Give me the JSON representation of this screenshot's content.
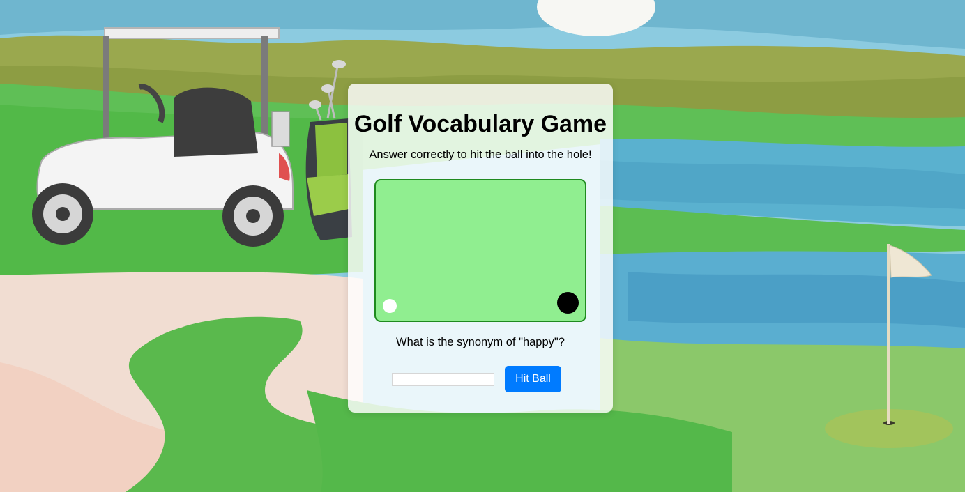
{
  "game": {
    "title": "Golf Vocabulary Game",
    "instructions": "Answer correctly to hit the ball into the hole!",
    "question": "What is the synonym of \"happy\"?",
    "answer_value": "",
    "answer_placeholder": "",
    "hit_button_label": "Hit Ball"
  },
  "course": {
    "fill_color": "#90ee90",
    "border_color": "#1f8a1f",
    "ball_color": "#ffffff",
    "hole_color": "#000000"
  },
  "colors": {
    "button_accent": "#007bff"
  },
  "background": {
    "scene": "watercolor golf course",
    "elements": [
      "golf-cart",
      "golf-bag",
      "water-hazard",
      "sand-bunker",
      "putting-green",
      "flag"
    ]
  }
}
